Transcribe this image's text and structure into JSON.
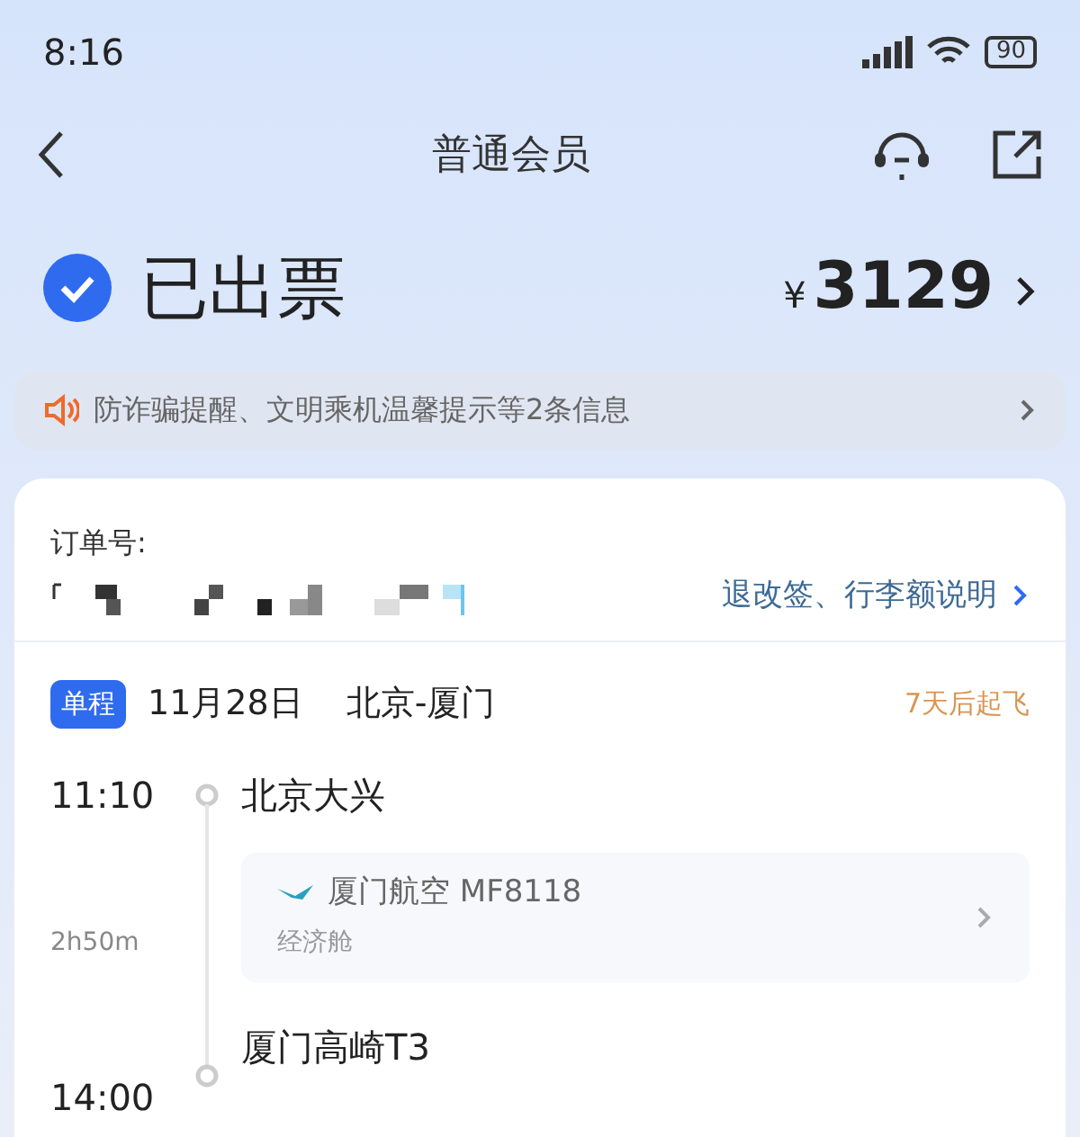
{
  "status_bar": {
    "time": "8:16",
    "battery": "90"
  },
  "nav": {
    "title": "普通会员"
  },
  "order_status": {
    "label": "已出票",
    "checked": true,
    "currency": "¥",
    "amount": "3129"
  },
  "notice": {
    "text": "防诈骗提醒、文明乘机温馨提示等2条信息"
  },
  "order": {
    "label": "订单号:",
    "link": "退改签、行李额说明"
  },
  "trip": {
    "badge": "单程",
    "date": "11月28日",
    "route": "北京-厦门",
    "countdown": "7天后起飞",
    "departure": {
      "time": "11:10",
      "airport": "北京大兴"
    },
    "duration": "2h50m",
    "flight": {
      "airline": "厦门航空 MF8118",
      "cabin": "经济舱"
    },
    "arrival": {
      "time": "14:00",
      "airport": "厦门高崎T3"
    }
  }
}
